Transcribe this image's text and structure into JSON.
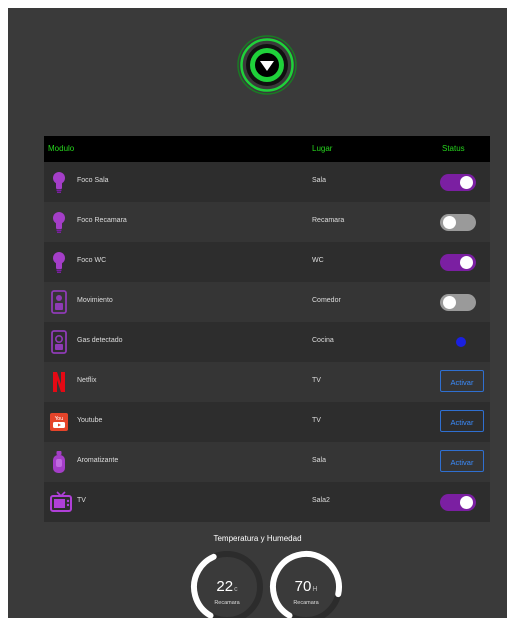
{
  "table": {
    "headers": {
      "module": "Modulo",
      "place": "Lugar",
      "status": "Status"
    },
    "rows": [
      {
        "module": "Foco Sala",
        "place": "Sala",
        "icon": "bulb-icon",
        "status": {
          "type": "toggle",
          "on": true
        }
      },
      {
        "module": "Foco Recamara",
        "place": "Recamara",
        "icon": "bulb-icon",
        "status": {
          "type": "toggle",
          "on": false
        }
      },
      {
        "module": "Foco WC",
        "place": "WC",
        "icon": "bulb-icon",
        "status": {
          "type": "toggle",
          "on": true
        }
      },
      {
        "module": "Movimiento",
        "place": "Comedor",
        "icon": "motion-sensor-icon",
        "status": {
          "type": "toggle",
          "on": false
        }
      },
      {
        "module": "Gas detectado",
        "place": "Cocina",
        "icon": "gas-sensor-icon",
        "status": {
          "type": "indicator",
          "color": "#1a20e0"
        }
      },
      {
        "module": "Netflix",
        "place": "TV",
        "icon": "netflix-icon",
        "status": {
          "type": "button",
          "label": "Activar"
        }
      },
      {
        "module": "Youtube",
        "place": "TV",
        "icon": "youtube-icon",
        "status": {
          "type": "button",
          "label": "Activar"
        }
      },
      {
        "module": "Aromatizante",
        "place": "Sala",
        "icon": "air-freshener-icon",
        "status": {
          "type": "button",
          "label": "Activar"
        }
      },
      {
        "module": "TV",
        "place": "Sala2",
        "icon": "tv-icon",
        "status": {
          "type": "toggle",
          "on": true
        }
      }
    ]
  },
  "sensors": {
    "title": "Temperatura y Humedad",
    "temperature": {
      "value": "22",
      "unit": "c",
      "label": "Recamara",
      "fraction": 0.35
    },
    "humidity": {
      "value": "70",
      "unit": "H",
      "label": "Recamara",
      "fraction": 0.7
    }
  },
  "colors": {
    "background": "#3a3a3a",
    "header_text": "#26d41d",
    "accent_purple": "#7b1fa2",
    "toggle_off": "#9a9a9a",
    "button_blue": "#3a8cff",
    "logo_green": "#1fd13a"
  }
}
